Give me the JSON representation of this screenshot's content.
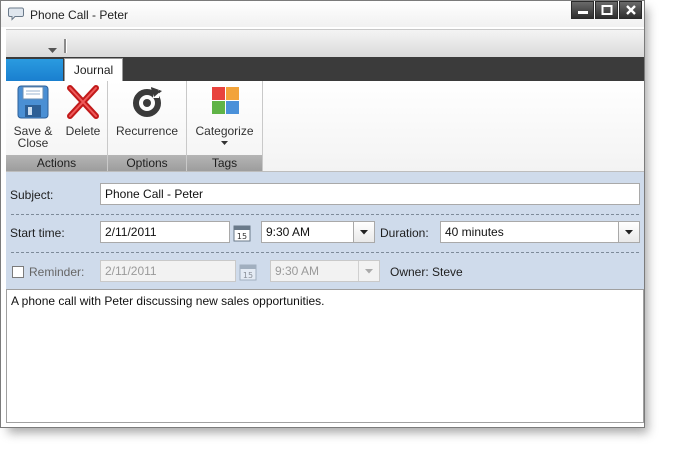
{
  "window": {
    "title": "Phone Call - Peter"
  },
  "ribbon": {
    "tabs": [
      {
        "label": ""
      },
      {
        "label": "Journal"
      }
    ],
    "groups": {
      "actions": {
        "label": "Actions",
        "save_close_label_line1": "Save &",
        "save_close_label_line2": "Close",
        "delete_label": "Delete"
      },
      "options": {
        "label": "Options",
        "recurrence_label": "Recurrence"
      },
      "tags": {
        "label": "Tags",
        "categorize_label": "Categorize"
      }
    }
  },
  "form": {
    "subject_label": "Subject:",
    "subject_value": "Phone Call - Peter",
    "start_time_label": "Start time:",
    "start_date_value": "2/11/2011",
    "calendar_day": "15",
    "start_time_value": "9:30 AM",
    "duration_label": "Duration:",
    "duration_value": "40 minutes",
    "reminder_label": "Reminder:",
    "reminder_checked": false,
    "reminder_date_value": "2/11/2011",
    "reminder_time_value": "9:30 AM",
    "owner_label": "Owner: Steve"
  },
  "notes": {
    "text": "A phone call with Peter discussing new sales opportunities."
  },
  "colors": {
    "tab_accent": "#1a8bd8",
    "form_background": "#cfdbeb",
    "title_button": "#3a3a3a"
  },
  "icons": [
    "chat-bubble-icon",
    "minimize-icon",
    "maximize-icon",
    "close-icon",
    "dropdown-arrow-icon",
    "save-disk-icon",
    "delete-x-icon",
    "recurrence-icon",
    "categorize-icon",
    "calendar-icon"
  ]
}
